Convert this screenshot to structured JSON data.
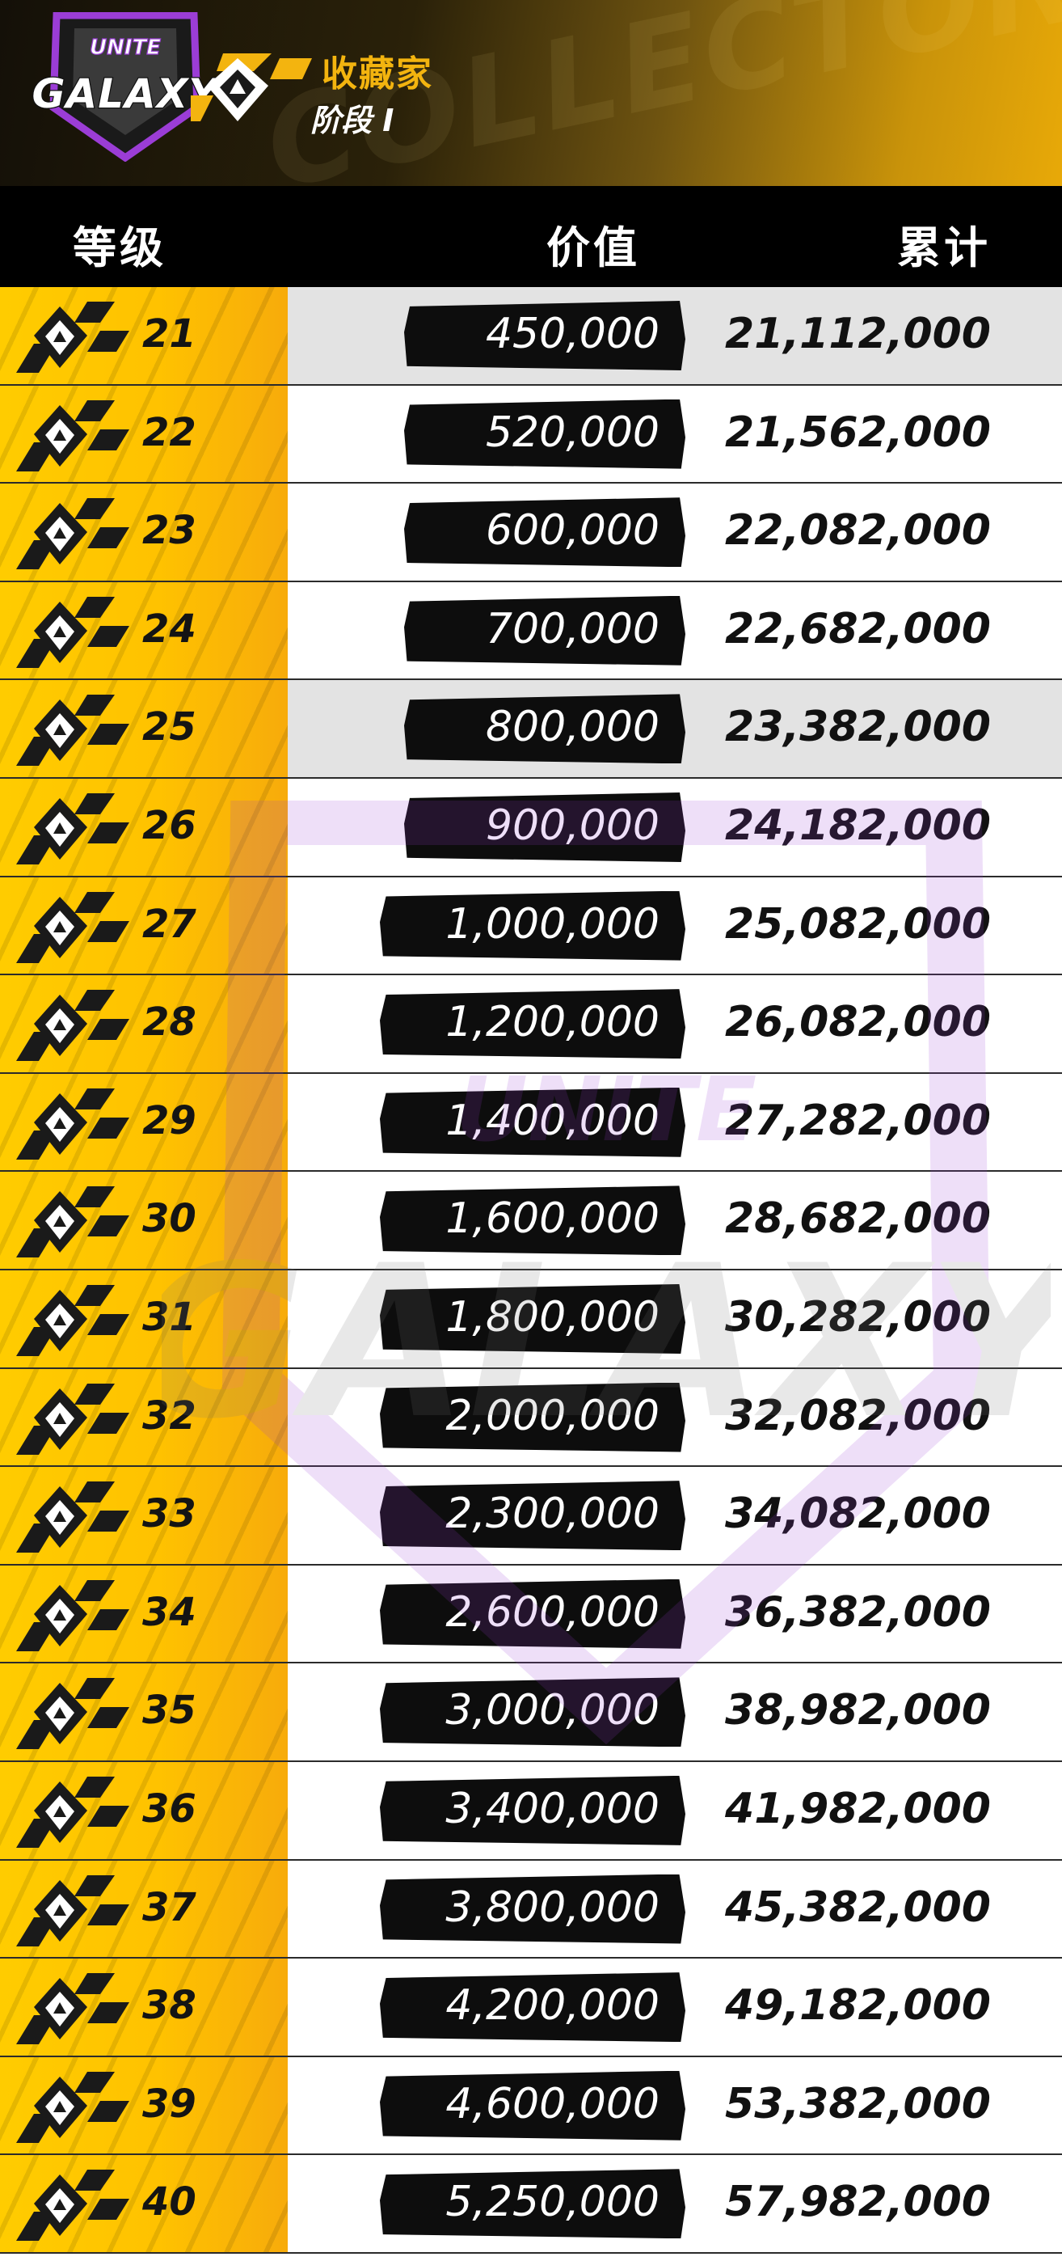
{
  "header": {
    "logo_small": "UNITE",
    "logo_big": "GALAXY",
    "title": "收藏家",
    "subtitle": "阶段 I"
  },
  "columns": {
    "level": "等级",
    "value": "价值",
    "total": "累计"
  },
  "colors": {
    "gold": "#ffc200",
    "header_dark": "#141008",
    "title_gold": "#f3b40f",
    "pill": "#0d0d0d",
    "logo_purple": "#9b3dd6"
  },
  "rows": [
    {
      "level": "21",
      "value": "450,000",
      "total": "21,112,000"
    },
    {
      "level": "22",
      "value": "520,000",
      "total": "21,562,000"
    },
    {
      "level": "23",
      "value": "600,000",
      "total": "22,082,000"
    },
    {
      "level": "24",
      "value": "700,000",
      "total": "22,682,000"
    },
    {
      "level": "25",
      "value": "800,000",
      "total": "23,382,000"
    },
    {
      "level": "26",
      "value": "900,000",
      "total": "24,182,000"
    },
    {
      "level": "27",
      "value": "1,000,000",
      "total": "25,082,000"
    },
    {
      "level": "28",
      "value": "1,200,000",
      "total": "26,082,000"
    },
    {
      "level": "29",
      "value": "1,400,000",
      "total": "27,282,000"
    },
    {
      "level": "30",
      "value": "1,600,000",
      "total": "28,682,000"
    },
    {
      "level": "31",
      "value": "1,800,000",
      "total": "30,282,000"
    },
    {
      "level": "32",
      "value": "2,000,000",
      "total": "32,082,000"
    },
    {
      "level": "33",
      "value": "2,300,000",
      "total": "34,082,000"
    },
    {
      "level": "34",
      "value": "2,600,000",
      "total": "36,382,000"
    },
    {
      "level": "35",
      "value": "3,000,000",
      "total": "38,982,000"
    },
    {
      "level": "36",
      "value": "3,400,000",
      "total": "41,982,000"
    },
    {
      "level": "37",
      "value": "3,800,000",
      "total": "45,382,000"
    },
    {
      "level": "38",
      "value": "4,200,000",
      "total": "49,182,000"
    },
    {
      "level": "39",
      "value": "4,600,000",
      "total": "53,382,000"
    },
    {
      "level": "40",
      "value": "5,250,000",
      "total": "57,982,000"
    }
  ]
}
